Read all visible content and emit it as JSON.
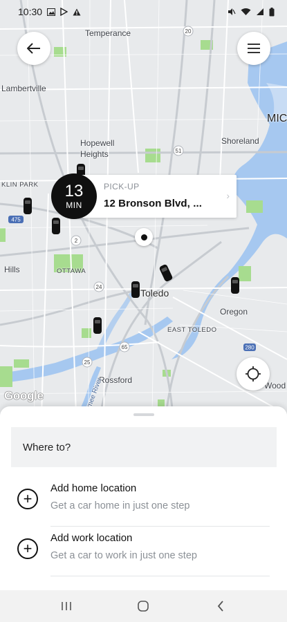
{
  "status_bar": {
    "time": "10:30",
    "left_icons": [
      "image-icon",
      "play-store-icon",
      "alert-icon"
    ],
    "right_icons": [
      "mute-icon",
      "wifi-icon",
      "signal-icon",
      "battery-icon"
    ]
  },
  "map": {
    "labels": {
      "temperance": "Temperance",
      "lambertville": "Lambertville",
      "hopewell": "Hopewell",
      "heights": "Heights",
      "shoreland": "Shoreland",
      "mic": "MIC",
      "klin_park": "KLIN PARK",
      "hills": "Hills",
      "ottawa": "OTTAWA",
      "toledo": "Toledo",
      "oregon": "Oregon",
      "east_toledo": "EAST TOLEDO",
      "rossford": "Rossford",
      "wood": "Wood",
      "maumee_river": "Maumee River",
      "route_475": "475",
      "route_24": "24",
      "route_25": "25",
      "route_280": "280",
      "route_65": "65",
      "route_2": "2",
      "route_20": "20",
      "route_51": "51"
    },
    "google_logo": "Google",
    "colors": {
      "land": "#e8eaec",
      "water": "#a6c8f0",
      "park": "#a7dc8f",
      "road": "#ffffff",
      "highway": "#c7cbd0"
    }
  },
  "pickup": {
    "eta_number": "13",
    "eta_unit": "MIN",
    "label": "PICK-UP",
    "address": "12 Bronson Blvd, ..."
  },
  "sheet": {
    "where_to": "Where to?",
    "items": [
      {
        "title": "Add home location",
        "subtitle": "Get a car home in just one step"
      },
      {
        "title": "Add work location",
        "subtitle": "Get a car to work in just one step"
      }
    ]
  },
  "nav": {
    "recents": "|||",
    "home": "○",
    "back": "‹"
  }
}
